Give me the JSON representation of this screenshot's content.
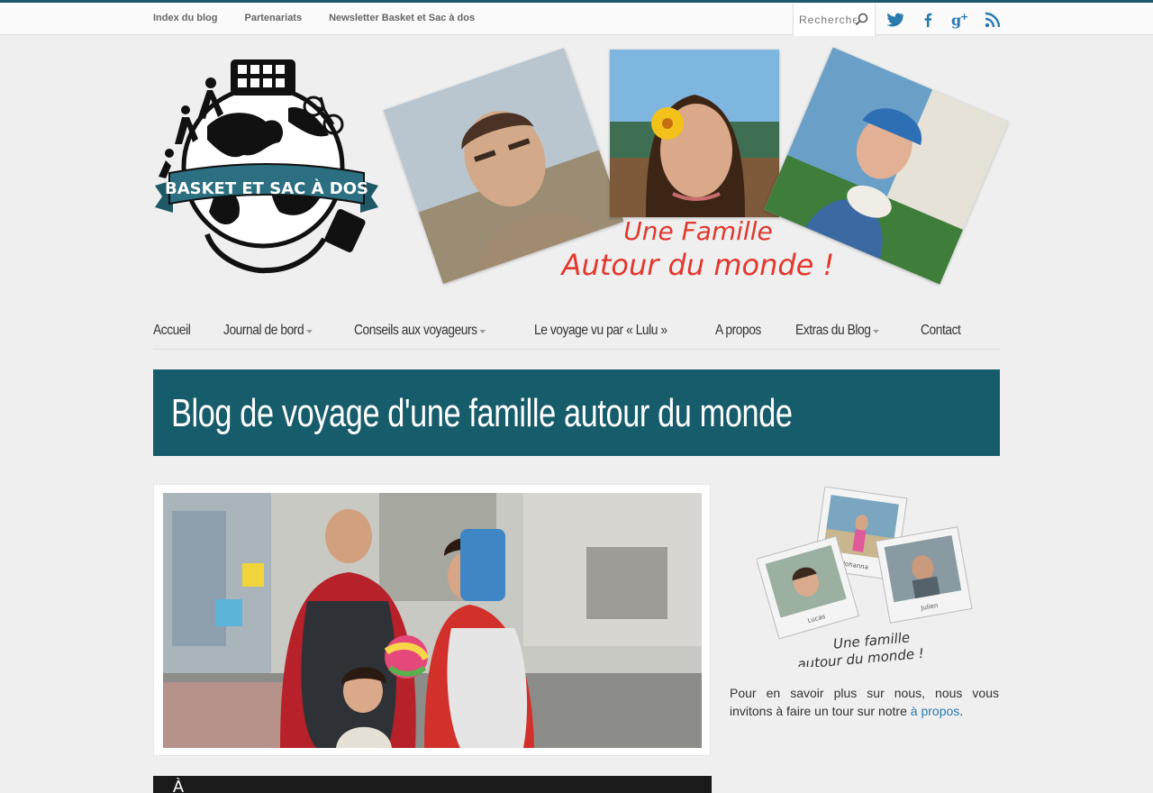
{
  "topnav": {
    "items": [
      "Index du blog",
      "Partenariats",
      "Newsletter Basket et Sac à dos"
    ]
  },
  "search": {
    "placeholder": "Rechercher"
  },
  "social": [
    "twitter-icon",
    "facebook-icon",
    "google-plus-icon",
    "rss-icon"
  ],
  "header": {
    "logo_text": "BASKET ET SAC À DOS",
    "tagline_line1": "Une Famille",
    "tagline_line2": "Autour du monde !"
  },
  "mainnav": {
    "items": [
      {
        "label": "Accueil",
        "dropdown": false
      },
      {
        "label": "Journal de bord",
        "dropdown": true
      },
      {
        "label": "Conseils aux voyageurs",
        "dropdown": true
      },
      {
        "label": "Le voyage vu par « Lulu »",
        "dropdown": false
      },
      {
        "label": "A propos",
        "dropdown": false
      },
      {
        "label": "Extras du Blog",
        "dropdown": true
      },
      {
        "label": "Contact",
        "dropdown": false
      }
    ]
  },
  "page": {
    "title": "Blog de voyage d'une famille autour du monde",
    "next_post_initial": "À"
  },
  "sidebar": {
    "polaroid_names": [
      "Johanna",
      "Lucas",
      "Julien"
    ],
    "polaroid_caption_1": "Une famille",
    "polaroid_caption_2": "autour du monde !",
    "text_before": "Pour en savoir plus sur nous, nous vous invitons à faire un tour sur notre ",
    "link_label": "à propos",
    "text_after": "."
  },
  "colors": {
    "accent": "#175c6b",
    "tagline": "#e2382e",
    "link": "#2a7ab0",
    "social": "#2a7ab0"
  }
}
